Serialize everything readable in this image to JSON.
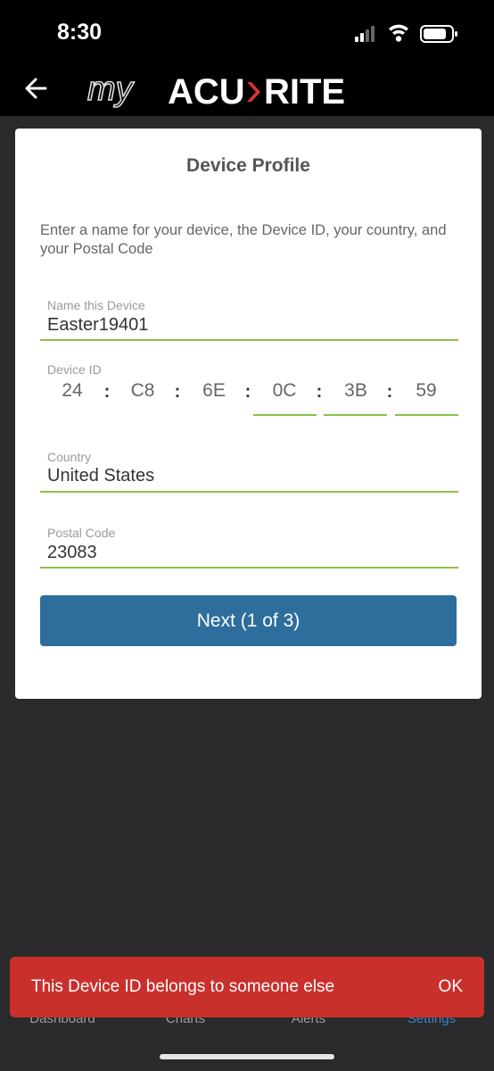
{
  "status_bar": {
    "time": "8:30"
  },
  "header": {
    "logo_text_my": "my",
    "logo_text_acu": "ACU",
    "logo_text_rite": "RITE",
    "accent_color": "#d9342b"
  },
  "card": {
    "title": "Device Profile",
    "instructions": "Enter a name for your device, the Device ID, your country, and your Postal Code",
    "name_field": {
      "label": "Name this Device",
      "value": "Easter19401"
    },
    "device_id": {
      "label": "Device ID",
      "segments": [
        "24",
        "C8",
        "6E",
        "0C",
        "3B",
        "59"
      ],
      "separator": ":"
    },
    "country_field": {
      "label": "Country",
      "value": "United States"
    },
    "postal_field": {
      "label": "Postal Code",
      "value": "23083"
    },
    "next_button": "Next (1 of 3)"
  },
  "tabs": [
    {
      "label": "Dashboard"
    },
    {
      "label": "Charts"
    },
    {
      "label": "Alerts"
    },
    {
      "label": "Settings",
      "active": true
    }
  ],
  "toast": {
    "message": "This Device ID belongs to someone else",
    "action": "OK"
  },
  "colors": {
    "input_underline": "#8bc34a",
    "primary_button": "#2d6e9c",
    "toast_bg": "#c9302c",
    "active_tab": "#3a82c4"
  }
}
